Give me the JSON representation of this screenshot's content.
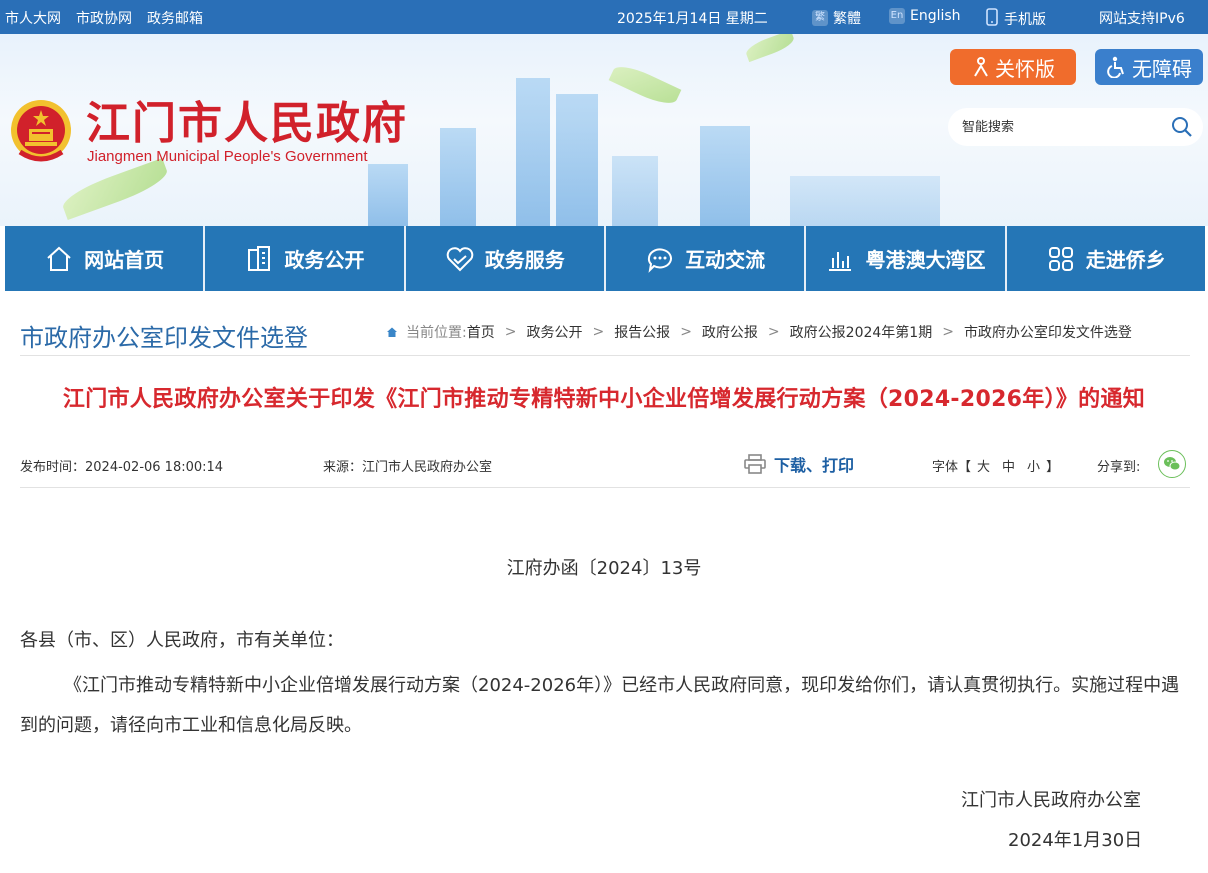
{
  "topbar": {
    "links": [
      "市人大网",
      "市政协网",
      "政务邮箱"
    ],
    "date": "2025年1月14日 星期二",
    "traditional": "繁體",
    "english": "English",
    "mobile": "手机版",
    "ipv6": "网站支持IPv6"
  },
  "header": {
    "title": "江门市人民政府",
    "subtitle": "Jiangmen Municipal People's Government",
    "care_label": "关怀版",
    "access_label": "无障碍",
    "search_placeholder": "智能搜索"
  },
  "nav": {
    "items": [
      {
        "label": "网站首页",
        "icon": "home-icon"
      },
      {
        "label": "政务公开",
        "icon": "building-icon"
      },
      {
        "label": "政务服务",
        "icon": "handshake-heart-icon"
      },
      {
        "label": "互动交流",
        "icon": "chat-bubble-icon"
      },
      {
        "label": "粤港澳大湾区",
        "icon": "bar-chart-icon"
      },
      {
        "label": "走进侨乡",
        "icon": "grid-apps-icon"
      }
    ]
  },
  "section": {
    "title": "市政府办公室印发文件选登",
    "breadcrumb_lead": "当前位置:",
    "breadcrumb": [
      "首页",
      "政务公开",
      "报告公报",
      "政府公报",
      "政府公报2024年第1期",
      "市政府办公室印发文件选登"
    ]
  },
  "article": {
    "title": "江门市人民政府办公室关于印发《江门市推动专精特新中小企业倍增发展行动方案（2024-2026年）》的通知",
    "publish_time": "发布时间：2024-02-06 18:00:14",
    "source": "来源：江门市人民政府办公室",
    "download_print": "下载、打印",
    "font_label": "字体【",
    "font_large": "大",
    "font_medium": "中",
    "font_small": "小",
    "font_close": "】",
    "share_label": "分享到:",
    "doc_number": "江府办函〔2024〕13号",
    "salutation": "各县（市、区）人民政府，市有关单位：",
    "paragraph": "《江门市推动专精特新中小企业倍增发展行动方案（2024-2026年）》已经市人民政府同意，现印发给你们，请认真贯彻执行。实施过程中遇到的问题，请径向市工业和信息化局反映。",
    "signature": "江门市人民政府办公室",
    "sign_date": "2024年1月30日"
  },
  "colors": {
    "topbar": "#2a6fb7",
    "nav": "#2576b6",
    "title_red": "#d7282e",
    "care_orange": "#f06c2c",
    "section_blue": "#2b6aa8"
  }
}
